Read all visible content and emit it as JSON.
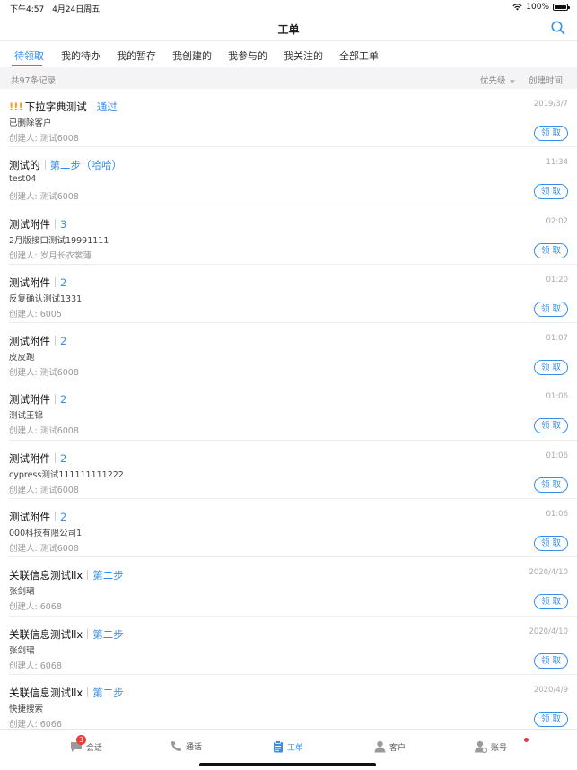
{
  "status_bar": {
    "time": "下午4:57",
    "date": "4月24日周五",
    "battery": "100%",
    "battery_level": 1.0
  },
  "nav": {
    "title": "工单"
  },
  "tabs": [
    {
      "label": "待领取",
      "active": true
    },
    {
      "label": "我的待办",
      "active": false
    },
    {
      "label": "我的暂存",
      "active": false
    },
    {
      "label": "我创建的",
      "active": false
    },
    {
      "label": "我参与的",
      "active": false
    },
    {
      "label": "我关注的",
      "active": false
    },
    {
      "label": "全部工单",
      "active": false
    }
  ],
  "filter": {
    "record_count": "共97条记录",
    "sort_priority": "优先级",
    "sort_time": "创建时间"
  },
  "claim_label": "领取",
  "items": [
    {
      "urgent": "!!!",
      "title": "下拉字典测试",
      "status": "通过",
      "sub": "已删除客户",
      "creator": "创建人: 测试6008",
      "time": "2019/3/7"
    },
    {
      "urgent": "",
      "title": "测试的",
      "status": "第二步（哈哈）",
      "sub": "test04",
      "creator": "创建人: 测试6008",
      "time": "11:34"
    },
    {
      "urgent": "",
      "title": "测试附件",
      "status": "3",
      "sub": "2月版接口测试19991111",
      "creator": "创建人: 岁月长衣裳薄",
      "time": "02:02"
    },
    {
      "urgent": "",
      "title": "测试附件",
      "status": "2",
      "sub": "反复确认测试1331",
      "creator": "创建人: 6005",
      "time": "01:20"
    },
    {
      "urgent": "",
      "title": "测试附件",
      "status": "2",
      "sub": "皮皮跑",
      "creator": "创建人: 测试6008",
      "time": "01:07"
    },
    {
      "urgent": "",
      "title": "测试附件",
      "status": "2",
      "sub": "测试王锦",
      "creator": "创建人: 测试6008",
      "time": "01:06"
    },
    {
      "urgent": "",
      "title": "测试附件",
      "status": "2",
      "sub": "cypress测试111111111222",
      "creator": "创建人: 测试6008",
      "time": "01:06"
    },
    {
      "urgent": "",
      "title": "测试附件",
      "status": "2",
      "sub": "000科技有限公司1",
      "creator": "创建人: 测试6008",
      "time": "01:06"
    },
    {
      "urgent": "",
      "title": "关联信息测试llx",
      "status": "第二步",
      "sub": "张剑珺",
      "creator": "创建人: 6068",
      "time": "2020/4/10"
    },
    {
      "urgent": "",
      "title": "关联信息测试llx",
      "status": "第二步",
      "sub": "张剑珺",
      "creator": "创建人: 6068",
      "time": "2020/4/10"
    },
    {
      "urgent": "",
      "title": "关联信息测试llx",
      "status": "第二步",
      "sub": "快捷搜索",
      "creator": "创建人: 6066",
      "time": "2020/4/9"
    }
  ],
  "bottom_tabs": [
    {
      "label": "会话",
      "icon": "chat-icon",
      "badge": "3"
    },
    {
      "label": "通话",
      "icon": "phone-icon"
    },
    {
      "label": "工单",
      "icon": "ticket-icon",
      "active": true
    },
    {
      "label": "客户",
      "icon": "customer-icon"
    },
    {
      "label": "账号",
      "icon": "account-icon"
    }
  ],
  "colors": {
    "accent": "#3a8ee6",
    "urgent": "#f0a020",
    "badge": "#f03a3a"
  }
}
